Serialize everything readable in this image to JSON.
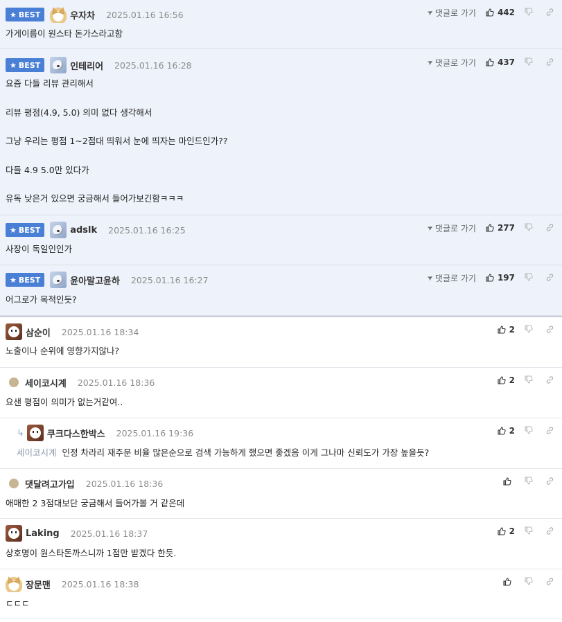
{
  "best_comments": [
    {
      "badge": "BEST",
      "nick": "우자차",
      "date": "2025.01.16 16:56",
      "avatar": "fox-avatar",
      "goto": "댓글로 가기",
      "likes": "442",
      "body": "가게이름이 원스타 돈가스라고함"
    },
    {
      "badge": "BEST",
      "nick": "인테리어",
      "date": "2025.01.16 16:28",
      "avatar": "dog-avatar",
      "goto": "댓글로 가기",
      "likes": "437",
      "body": "요즘 다들 리뷰 관리해서\n\n리뷰 평점(4.9, 5.0) 의미 없다 생각해서\n\n그냥 우리는 평점 1~2점대 띄워서 눈에 띄자는 마인드인가??\n\n다들 4.9 5.0만 있다가\n\n유독 낮은거 있으면 궁금해서 들어가보긴함ㅋㅋㅋ"
    },
    {
      "badge": "BEST",
      "nick": "adslk",
      "date": "2025.01.16 16:25",
      "avatar": "dog-avatar",
      "goto": "댓글로 가기",
      "likes": "277",
      "body": "사장이 독일인인가"
    },
    {
      "badge": "BEST",
      "nick": "윤아말고윤하",
      "date": "2025.01.16 16:27",
      "avatar": "dog-avatar",
      "goto": "댓글로 가기",
      "likes": "197",
      "body": "어그로가 목적인듯?"
    }
  ],
  "comments": [
    {
      "nick": "삼순이",
      "date": "2025.01.16 18:34",
      "avatar": "puppy-avatar",
      "likes": "2",
      "body": "노출이나 순위에 영향가지않나?"
    },
    {
      "nick": "세이코시계",
      "date": "2025.01.16 18:36",
      "avatar": "dot-avatar",
      "likes": "2",
      "body": "요샌 평점이 의미가 없는거같여.."
    },
    {
      "nick": "쿠크다스한박스",
      "date": "2025.01.16 19:36",
      "avatar": "puppy-avatar",
      "likes": "2",
      "reply_to": "세이코시계",
      "body": "인정 차라리 재주문 비율 많은순으로 검색 가능하게 했으면 좋겠음 이게 그나마 신뢰도가 가장 높을듯?"
    },
    {
      "nick": "댓달려고가입",
      "date": "2025.01.16 18:36",
      "avatar": "dot-avatar",
      "likes": "",
      "body": "애매한 2 3점대보단 궁금해서 들어가볼 거 같은데"
    },
    {
      "nick": "Laking",
      "date": "2025.01.16 18:37",
      "avatar": "puppy-avatar",
      "likes": "2",
      "body": "상호명이 원스타돈까스니까 1점만 받겠다 한듯."
    },
    {
      "nick": "장문맨",
      "date": "2025.01.16 18:38",
      "avatar": "fox-avatar",
      "likes": "",
      "body": "ㄷㄷㄷ"
    }
  ],
  "colors": {
    "best_bg": "#eef2fa",
    "badge": "#4a7fd6",
    "reply_to": "#8a94a8"
  }
}
